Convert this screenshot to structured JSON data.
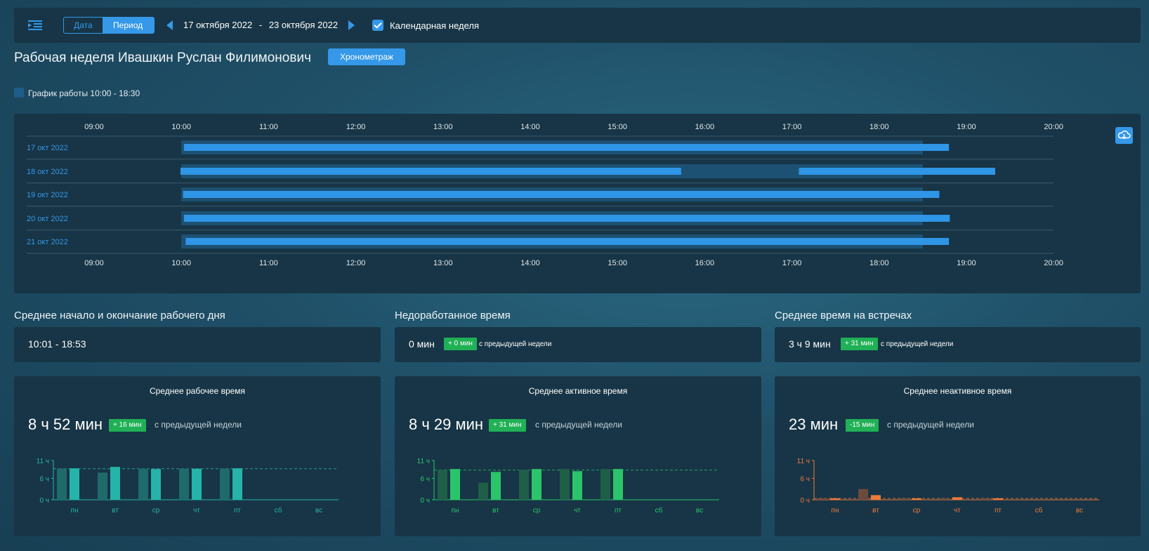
{
  "topbar": {
    "mode_tabs": [
      "Дата",
      "Период"
    ],
    "active_tab": "Период",
    "date_from": "17 октября 2022",
    "separator": "-",
    "date_to": "23 октября 2022",
    "calendar_week_label": "Календарная неделя",
    "calendar_week_checked": true
  },
  "header": {
    "title": "Рабочая неделя Ивашкин Руслан Филимонович",
    "timing_button": "Хронометраж",
    "legend_label": "График работы 10:00 - 18:30"
  },
  "timeline": {
    "hours": [
      "09:00",
      "10:00",
      "11:00",
      "12:00",
      "13:00",
      "14:00",
      "15:00",
      "16:00",
      "17:00",
      "18:00",
      "19:00",
      "20:00"
    ],
    "schedule_start": 10.0,
    "schedule_end": 18.5,
    "rows": [
      {
        "label": "17 окт 2022",
        "segments": [
          [
            10.03,
            18.8
          ]
        ]
      },
      {
        "label": "18 окт 2022",
        "segments": [
          [
            9.99,
            15.73
          ],
          [
            17.08,
            19.33
          ]
        ]
      },
      {
        "label": "19 окт 2022",
        "segments": [
          [
            10.02,
            18.69
          ]
        ]
      },
      {
        "label": "20 окт 2022",
        "segments": [
          [
            10.03,
            18.81
          ]
        ]
      },
      {
        "label": "21 окт 2022",
        "segments": [
          [
            10.05,
            10.55
          ],
          [
            10.55,
            18.8
          ]
        ]
      }
    ]
  },
  "stats": {
    "start_end": {
      "title": "Среднее начало и окончание рабочего дня",
      "value": "10:01 - 18:53"
    },
    "underworked": {
      "title": "Недоработанное время",
      "value": "0 мин",
      "delta": "+ 0 мин",
      "note": "с предыдущей недели"
    },
    "meetings": {
      "title": "Среднее время на встречах",
      "value": "3 ч 9 мин",
      "delta": "+ 31 мин",
      "note": "с предыдущей недели"
    }
  },
  "chart_data": [
    {
      "type": "bar",
      "title": "Среднее рабочее время",
      "value_label": "8 ч 52 мин",
      "delta": "+ 16 мин",
      "note": "с предыдущей недели",
      "categories": [
        "пн",
        "вт",
        "ср",
        "чт",
        "пт",
        "сб",
        "вс"
      ],
      "y_ticks": [
        "11 ч",
        "6 ч",
        "0 ч"
      ],
      "ylim": [
        0,
        11
      ],
      "average_line": 8.7,
      "series": [
        {
          "values": [
            8.7,
            7.6,
            8.7,
            8.7,
            8.7,
            0,
            0
          ]
        },
        {
          "values": [
            8.8,
            9.2,
            8.6,
            8.7,
            8.8,
            0,
            0
          ]
        }
      ],
      "colors": [
        "#1f6a6a",
        "#26b3a9"
      ],
      "axis_color": "#26b3a9"
    },
    {
      "type": "bar",
      "title": "Среднее активное время",
      "value_label": "8 ч 29 мин",
      "delta": "+ 31 мин",
      "note": "с предыдущей недели",
      "categories": [
        "пн",
        "вт",
        "ср",
        "чт",
        "пт",
        "сб",
        "вс"
      ],
      "y_ticks": [
        "11 ч",
        "6 ч",
        "0 ч"
      ],
      "ylim": [
        0,
        11
      ],
      "average_line": 8.3,
      "series": [
        {
          "values": [
            8.3,
            4.8,
            8.4,
            8.6,
            8.6,
            0,
            0
          ]
        },
        {
          "values": [
            8.6,
            7.8,
            8.6,
            8.0,
            8.6,
            0,
            0
          ]
        }
      ],
      "colors": [
        "#1f5f48",
        "#2cc46a"
      ],
      "axis_color": "#2cc46a"
    },
    {
      "type": "bar",
      "title": "Среднее неактивное время",
      "value_label": "23 мин",
      "delta": "-15 мин",
      "note": "с предыдущей недели",
      "categories": [
        "пн",
        "вт",
        "ср",
        "чт",
        "пт",
        "сб",
        "вс"
      ],
      "y_ticks": [
        "11 ч",
        "6 ч",
        "0 ч"
      ],
      "ylim": [
        0,
        11
      ],
      "average_line": 0.4,
      "series": [
        {
          "values": [
            0.4,
            3.0,
            0.4,
            0.4,
            0.4,
            0,
            0
          ]
        },
        {
          "values": [
            0.4,
            1.3,
            0.4,
            0.7,
            0.4,
            0,
            0
          ]
        }
      ],
      "colors": [
        "#6b4a3c",
        "#ef7a3a"
      ],
      "axis_color": "#ef7a3a"
    }
  ]
}
